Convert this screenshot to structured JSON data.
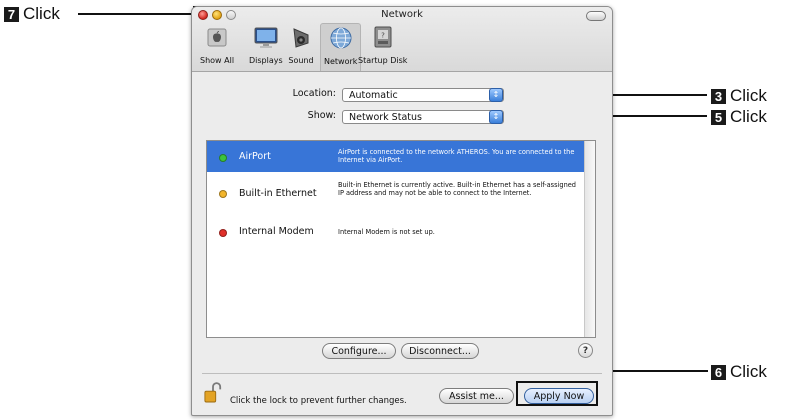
{
  "window": {
    "title": "Network"
  },
  "toolbar": {
    "items": [
      {
        "label": "Show All",
        "icon": "apple-icon"
      },
      {
        "label": "Displays",
        "icon": "display-icon"
      },
      {
        "label": "Sound",
        "icon": "speaker-icon"
      },
      {
        "label": "Network",
        "icon": "globe-icon",
        "selected": true
      },
      {
        "label": "Startup Disk",
        "icon": "disk-icon"
      }
    ]
  },
  "form": {
    "location_label": "Location:",
    "location_value": "Automatic",
    "show_label": "Show:",
    "show_value": "Network Status"
  },
  "status_list": [
    {
      "name": "AirPort",
      "status": "green",
      "selected": true,
      "description": "AirPort is connected to the network ATHEROS. You are connected to the Internet via AirPort."
    },
    {
      "name": "Built-in Ethernet",
      "status": "yellow",
      "selected": false,
      "description": "Built-in Ethernet is currently active. Built-in Ethernet has a self-assigned IP address and may not be able to connect to the Internet."
    },
    {
      "name": "Internal Modem",
      "status": "red",
      "selected": false,
      "description": "Internal Modem is not set up."
    }
  ],
  "buttons": {
    "configure": "Configure...",
    "disconnect": "Disconnect...",
    "help": "?",
    "assist": "Assist me...",
    "apply": "Apply Now"
  },
  "lock_text": "Click the lock to prevent further changes.",
  "callouts": [
    {
      "num": "7",
      "word": "Click"
    },
    {
      "num": "3",
      "word": "Click"
    },
    {
      "num": "5",
      "word": "Click"
    },
    {
      "num": "6",
      "word": "Click"
    }
  ],
  "colors": {
    "selection": "#3875d7",
    "status_green": "#3cc43c",
    "status_yellow": "#f2b52c",
    "status_red": "#e0302a"
  }
}
